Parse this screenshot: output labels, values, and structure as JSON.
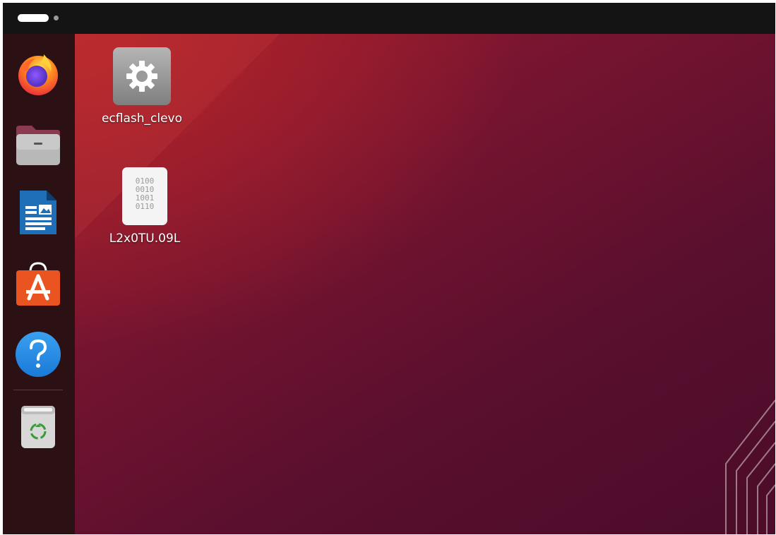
{
  "topbar": {
    "workspace_indicator": "workspace-pill"
  },
  "dock": {
    "items": [
      {
        "name": "firefox",
        "icon": "firefox-icon"
      },
      {
        "name": "files",
        "icon": "folder-icon"
      },
      {
        "name": "writer",
        "icon": "libreoffice-writer-icon"
      },
      {
        "name": "app-center",
        "icon": "shopping-bag-icon"
      },
      {
        "name": "help",
        "icon": "help-icon"
      },
      {
        "name": "trash",
        "icon": "trash-icon"
      }
    ]
  },
  "desktop": {
    "icons": [
      {
        "label": "ecflash_clevo",
        "icon": "gear-icon"
      },
      {
        "label": "L2x0TU.09L",
        "icon": "binary-file-icon",
        "binary_lines": [
          "0100",
          "0010",
          "1001",
          "0110"
        ]
      }
    ]
  },
  "colors": {
    "accent_orange": "#e95420",
    "wallpaper_dark": "#4b0c2a",
    "wallpaper_red": "#b3242a"
  }
}
